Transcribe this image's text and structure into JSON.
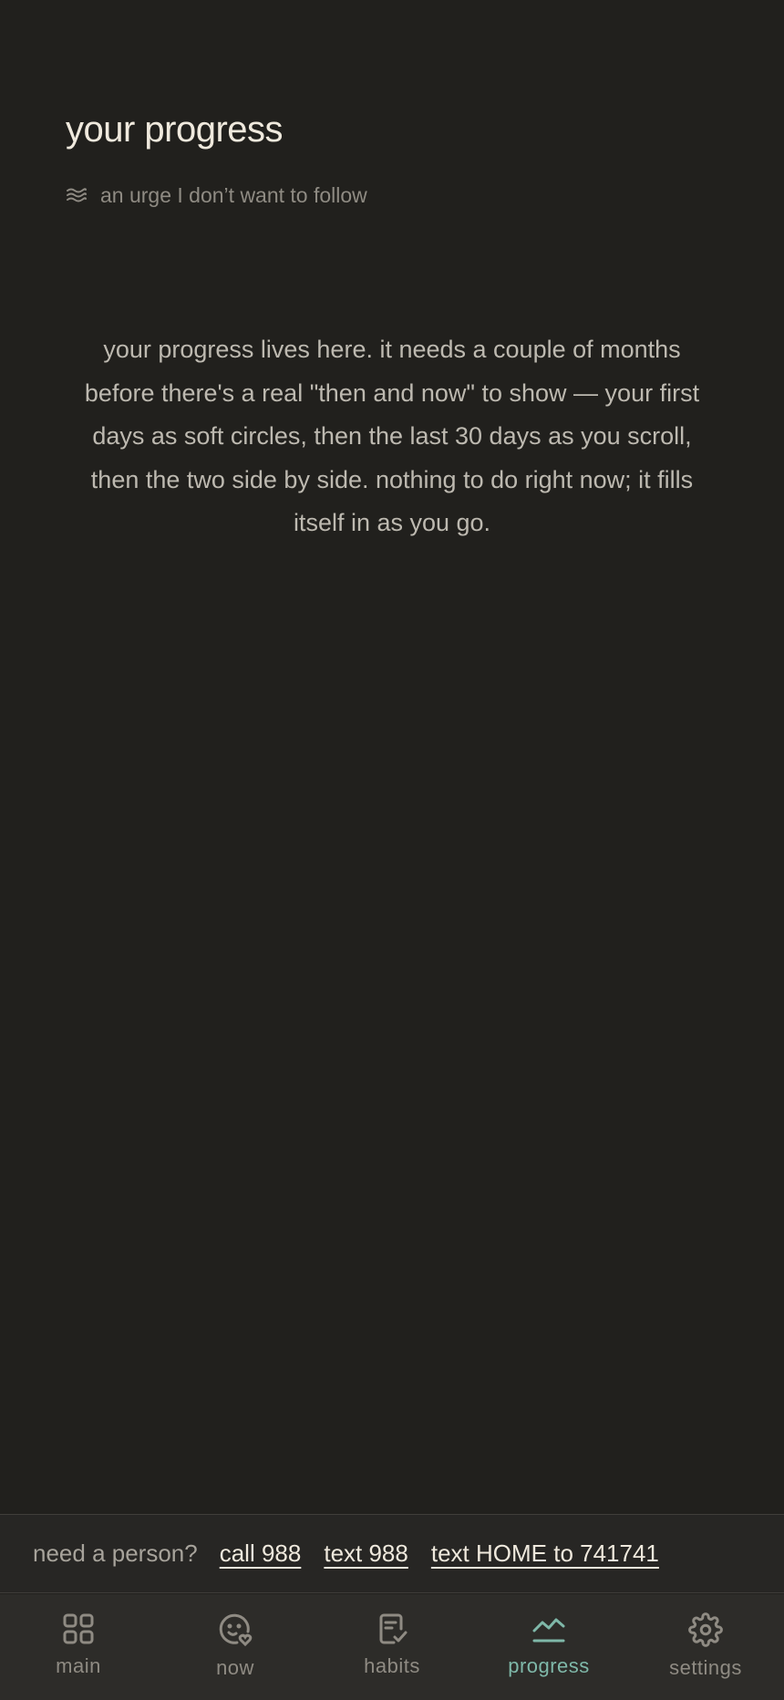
{
  "header": {
    "title": "your progress",
    "subtitle": "an urge I don’t want to follow",
    "subtitle_icon": "waves-icon"
  },
  "main": {
    "empty_message": "your progress lives here. it needs a couple of months before there's a real \"then and now\" to show — your first days as soft circles, then the last 30 days as you scroll, then the two side by side. nothing to do right now; it fills itself in as you go."
  },
  "helpline": {
    "prompt": "need a person?",
    "links": [
      "call 988",
      "text 988",
      "text HOME to 741741"
    ]
  },
  "tabbar": {
    "active": "progress",
    "accent_color": "#7fb8a9",
    "items": [
      {
        "label": "main",
        "icon": "grid-icon"
      },
      {
        "label": "now",
        "icon": "face-heart-icon"
      },
      {
        "label": "habits",
        "icon": "checklist-icon"
      },
      {
        "label": "progress",
        "icon": "trend-icon"
      },
      {
        "label": "settings",
        "icon": "gear-icon"
      }
    ]
  },
  "colors": {
    "background": "#21201d",
    "text_primary": "#efe9dd",
    "text_muted": "#8f8b83"
  }
}
